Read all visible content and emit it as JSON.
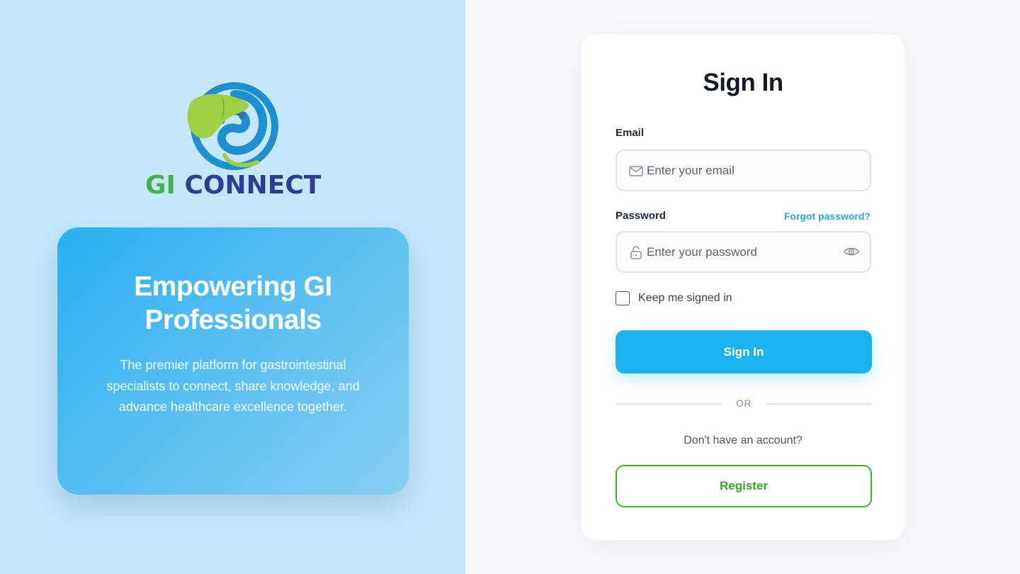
{
  "brand": {
    "logo_text_gi": "GI",
    "logo_text_connect": "CONNECT",
    "colors": {
      "green": "#3fb34a",
      "navy": "#2b3e93",
      "blue": "#1f8fd1",
      "liver": "#9fd043"
    }
  },
  "promo": {
    "title": "Empowering GI Professionals",
    "description": "The premier platform for gastrointestinal specialists to connect, share knowledge, and advance healthcare excellence together."
  },
  "signin": {
    "title": "Sign In",
    "email_label": "Email",
    "email_placeholder": "Enter your email",
    "email_value": "",
    "password_label": "Password",
    "password_placeholder": "Enter your password",
    "password_value": "",
    "forgot_password": "Forgot password?",
    "remember_label": "Keep me signed in",
    "remember_checked": false,
    "submit_label": "Sign In",
    "divider_text": "OR",
    "no_account_text": "Don't have an account?",
    "register_label": "Register"
  },
  "colors": {
    "primary": "#1ab3ef",
    "register_green": "#3ab52a",
    "link": "#27a8d8",
    "left_bg": "#c4e7fc"
  },
  "icons": {
    "email": "mail-icon",
    "password": "lock-icon",
    "toggle_visibility": "eye-icon"
  }
}
